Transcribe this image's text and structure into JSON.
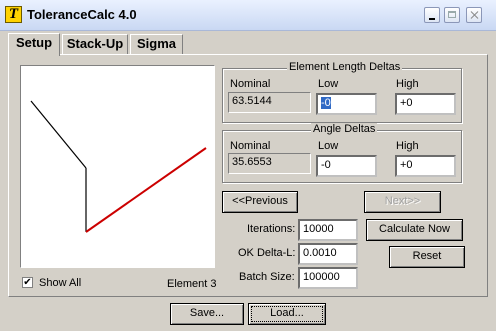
{
  "window": {
    "title": "ToleranceCalc 4.0",
    "icon_letter": "T"
  },
  "tabs": [
    {
      "label": "Setup"
    },
    {
      "label": "Stack-Up"
    },
    {
      "label": "Sigma"
    }
  ],
  "canvas": {
    "element_segments": [
      {
        "name": "element-1",
        "color": "#000000"
      },
      {
        "name": "element-2",
        "color": "#000000"
      },
      {
        "name": "element-3-highlighted",
        "color": "#cc0000"
      }
    ]
  },
  "show_all": {
    "label": "Show All",
    "checked": true
  },
  "element_label": "Element 3",
  "length_deltas": {
    "title": "Element Length Deltas",
    "nominal_label": "Nominal",
    "low_label": "Low",
    "high_label": "High",
    "nominal": "63.5144",
    "low": "-0",
    "high": "+0"
  },
  "angle_deltas": {
    "title": "Angle Deltas",
    "nominal_label": "Nominal",
    "low_label": "Low",
    "high_label": "High",
    "nominal": "35.6553",
    "low": "-0",
    "high": "+0"
  },
  "nav": {
    "previous": "<<Previous",
    "next": "Next>>"
  },
  "iterations": {
    "label": "Iterations:",
    "value": "10000"
  },
  "ok_delta": {
    "label": "OK Delta-L:",
    "value": "0.0010"
  },
  "batch_size": {
    "label": "Batch Size:",
    "value": "100000"
  },
  "buttons": {
    "calculate": "Calculate Now",
    "reset": "Reset",
    "save": "Save...",
    "load": "Load..."
  }
}
